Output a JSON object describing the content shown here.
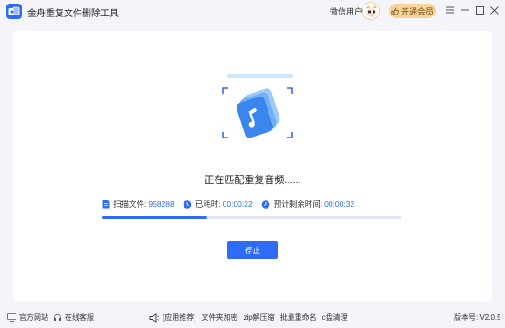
{
  "app": {
    "title": "金舟重复文件删除工具"
  },
  "header": {
    "user_label": "微信用户",
    "vip_label": "开通会员",
    "brand_color": "#2f6cf6",
    "vip_color": "#f6d49a"
  },
  "main": {
    "status": "正在匹配重复音频......",
    "stats": {
      "scanned_label": "扫描文件:",
      "scanned_value": "958288",
      "elapsed_label": "已耗时:",
      "elapsed_value": "00:00:22",
      "remaining_label": "预计剩余时间:",
      "remaining_value": "00:00:32"
    },
    "progress_percent": 35,
    "stop_label": "停止"
  },
  "footer": {
    "website_label": "官方网站",
    "service_label": "在线客服",
    "promo_label": "[应用推荐]",
    "promo_items": [
      "文件夹加密",
      "zip解压缩",
      "批量重命名",
      "c盘清理"
    ],
    "version": "版本号: V2.0.5"
  }
}
